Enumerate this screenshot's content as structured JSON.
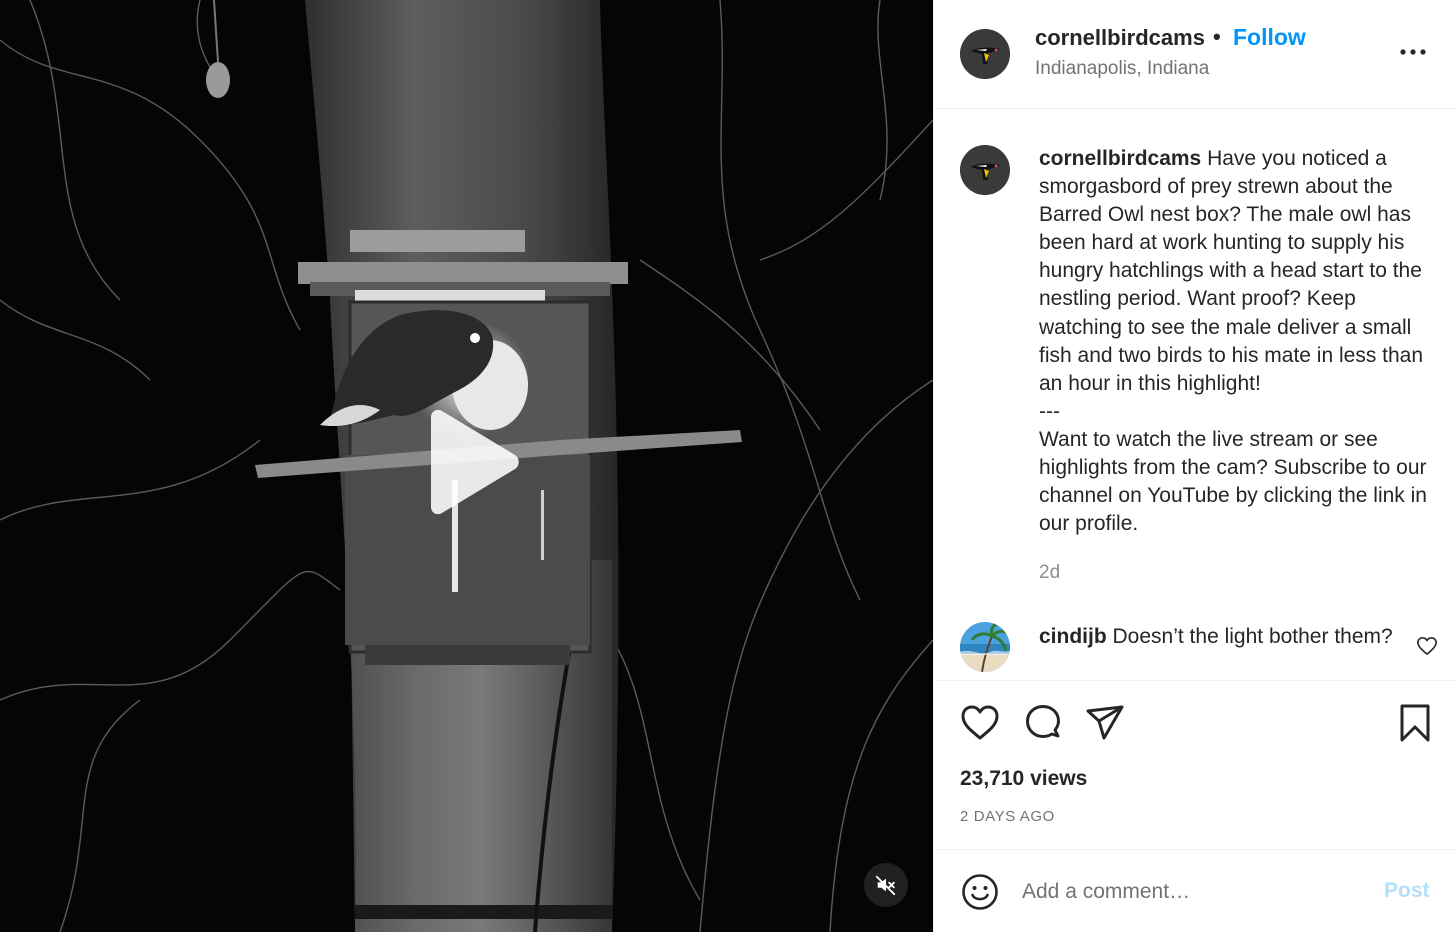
{
  "post": {
    "author": "cornellbirdcams",
    "separator": "•",
    "follow_label": "Follow",
    "location": "Indianapolis, Indiana",
    "more_icon": "more-horizontal-icon"
  },
  "caption": {
    "username": "cornellbirdcams",
    "paragraph1": "Have you noticed a smorgasbord of prey strewn about the Barred Owl nest box? The male owl has been hard at work hunting to supply his hungry hatchlings with a head start to the nestling period. Want proof? Keep watching to see the male deliver a small fish and two birds to his mate in less than an hour in this highlight!",
    "divider": "---",
    "paragraph2": "Want to watch the live stream or see highlights from the cam? Subscribe to our channel on YouTube by clicking the link in our profile.",
    "time_ago": "2d"
  },
  "comments": [
    {
      "username": "cindijb",
      "text": "Doesn’t the light bother them?"
    }
  ],
  "stats": {
    "views": "23,710 views",
    "posted": "2 DAYS AGO"
  },
  "comment_box": {
    "placeholder": "Add a comment…",
    "post_label": "Post"
  },
  "media": {
    "play_icon": "play-icon",
    "mute_icon": "speaker-muted-icon"
  },
  "colors": {
    "follow_blue": "#0095f6",
    "post_disabled": "#b2dffc",
    "muted_text": "#737373"
  }
}
